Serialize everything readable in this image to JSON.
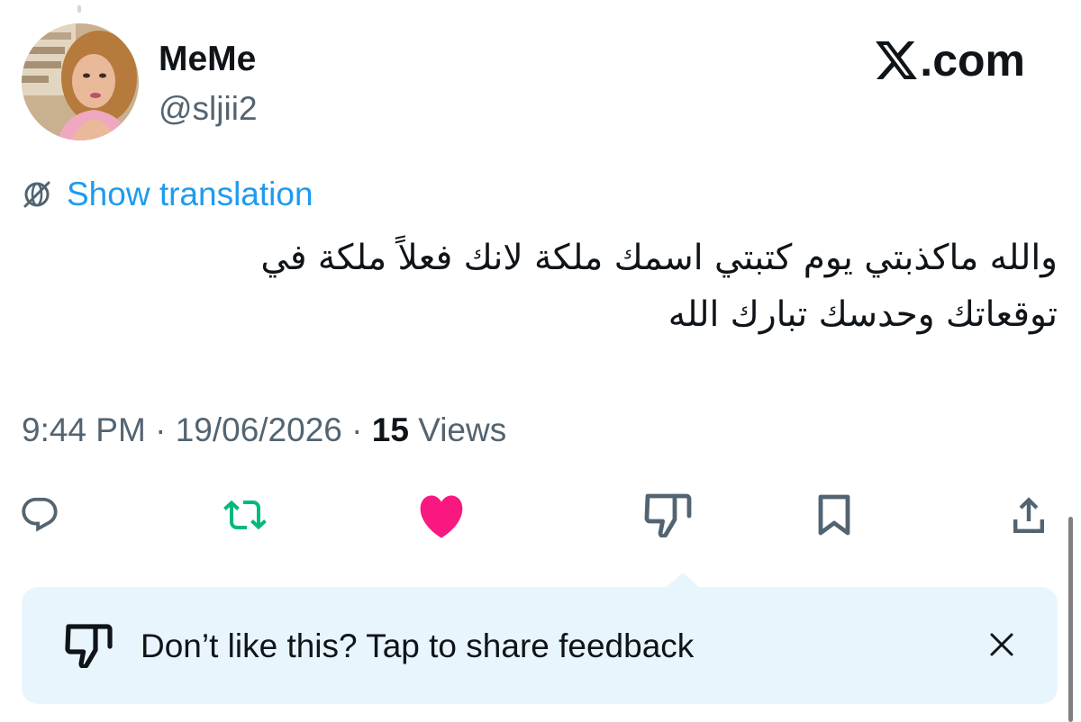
{
  "author": {
    "display_name": "MeMe",
    "handle": "@sljii2",
    "avatar_icon": "profile-photo"
  },
  "brand": {
    "logo_icon": "x-logo-icon",
    "suffix": ".com"
  },
  "translation": {
    "icon": "globe-slash-icon",
    "label": "Show translation"
  },
  "tweet": {
    "text": "والله ماكذبتي يوم كتبتي اسمك ملكة لانك فعلاً ملكة في توقعاتك وحدسك تبارك الله"
  },
  "meta": {
    "time": "9:44 PM",
    "separator": " · ",
    "date": "19/06/2026",
    "views_count": "15",
    "views_label": " Views"
  },
  "actions": {
    "reply_icon": "reply-icon",
    "retweet_icon": "retweet-icon",
    "like_icon": "heart-icon",
    "dislike_icon": "thumbs-down-icon",
    "bookmark_icon": "bookmark-icon",
    "share_icon": "share-icon",
    "retweet_color": "#00ba7c",
    "like_color": "#f91880",
    "icon_color": "#536471"
  },
  "feedback": {
    "icon": "thumbs-down-icon",
    "text": "Don’t like this? Tap to share feedback",
    "close_icon": "close-icon"
  },
  "colors": {
    "link": "#1d9bf0",
    "secondary_text": "#536471",
    "primary_text": "#0f1419",
    "feedback_bg": "#e8f5fd"
  }
}
